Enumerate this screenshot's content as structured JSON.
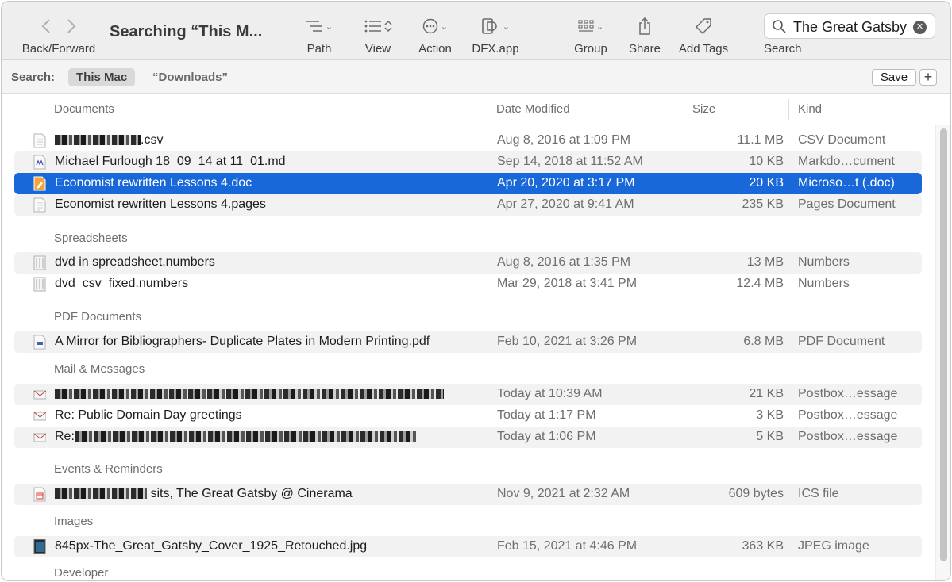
{
  "toolbar": {
    "back_forward_label": "Back/Forward",
    "title": "Searching “This M...",
    "path_label": "Path",
    "view_label": "View",
    "action_label": "Action",
    "dfx_label": "DFX.app",
    "group_label": "Group",
    "share_label": "Share",
    "tags_label": "Add Tags",
    "search_label": "Search",
    "search_value": "The Great Gatsby"
  },
  "scope": {
    "label": "Search:",
    "this_mac": "This Mac",
    "downloads": "“Downloads”",
    "save": "Save",
    "add": "+"
  },
  "columns": {
    "name": "Documents",
    "date": "Date Modified",
    "size": "Size",
    "kind": "Kind"
  },
  "groups": {
    "spreadsheets": "Spreadsheets",
    "pdf": "PDF Documents",
    "mail": "Mail & Messages",
    "events": "Events & Reminders",
    "images": "Images",
    "developer": "Developer"
  },
  "rows": [
    {
      "name": ".csv",
      "date": "Aug 8, 2016 at 1:09 PM",
      "size": "11.1 MB",
      "kind": "CSV Document"
    },
    {
      "name": "Michael Furlough 18_09_14 at 11_01.md",
      "date": "Sep 14, 2018 at 11:52 AM",
      "size": "10 KB",
      "kind": "Markdo…cument"
    },
    {
      "name": "Economist rewritten Lessons 4.doc",
      "date": "Apr 20, 2020 at 3:17 PM",
      "size": "20 KB",
      "kind": "Microso…t (.doc)"
    },
    {
      "name": "Economist rewritten Lessons 4.pages",
      "date": "Apr 27, 2020 at 9:41 AM",
      "size": "235 KB",
      "kind": "Pages Document"
    },
    {
      "name": "dvd in spreadsheet.numbers",
      "date": "Aug 8, 2016 at 1:35 PM",
      "size": "13 MB",
      "kind": "Numbers"
    },
    {
      "name": "dvd_csv_fixed.numbers",
      "date": "Mar 29, 2018 at 3:41 PM",
      "size": "12.4 MB",
      "kind": "Numbers"
    },
    {
      "name": "A Mirror for Bibliographers- Duplicate Plates in Modern Printing.pdf",
      "date": "Feb 10, 2021 at 3:26 PM",
      "size": "6.8 MB",
      "kind": "PDF Document"
    },
    {
      "name": "",
      "date": "Today at 10:39 AM",
      "size": "21 KB",
      "kind": "Postbox…essage"
    },
    {
      "name": "Re: Public Domain Day greetings",
      "date": "Today at 1:17 PM",
      "size": "3 KB",
      "kind": "Postbox…essage"
    },
    {
      "name": "Re:",
      "date": "Today at 1:06 PM",
      "size": "5 KB",
      "kind": "Postbox…essage"
    },
    {
      "name": " sits, The Great Gatsby @ Cinerama",
      "date": "Nov 9, 2021 at 2:32 AM",
      "size": "609 bytes",
      "kind": "ICS file"
    },
    {
      "name": "845px-The_Great_Gatsby_Cover_1925_Retouched.jpg",
      "date": "Feb 15, 2021 at 4:46 PM",
      "size": "363 KB",
      "kind": "JPEG image"
    }
  ]
}
